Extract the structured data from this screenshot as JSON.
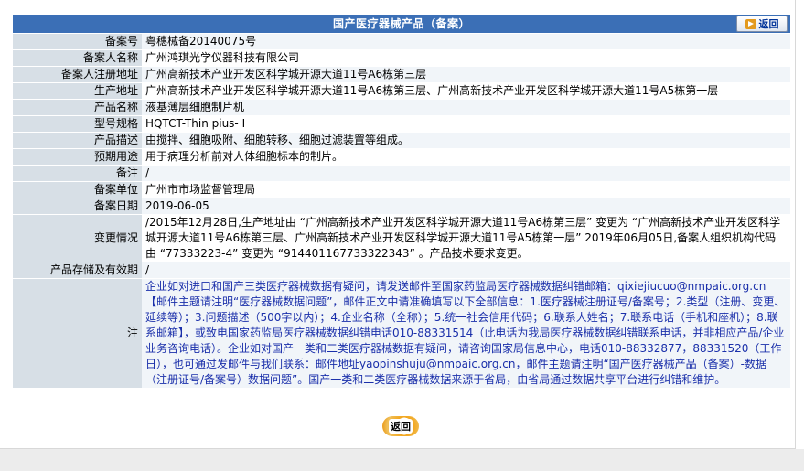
{
  "header": {
    "title": "国产医疗器械产品（备案）",
    "back_label": "返回"
  },
  "rows": [
    {
      "label": "备案号",
      "value": "粤穗械备20140075号"
    },
    {
      "label": "备案人名称",
      "value": "广州鸿琪光学仪器科技有限公司"
    },
    {
      "label": "备案人注册地址",
      "value": "广州高新技术产业开发区科学城开源大道11号A6栋第三层"
    },
    {
      "label": "生产地址",
      "value": "广州高新技术产业开发区科学城开源大道11号A6栋第三层、广州高新技术产业开发区科学城开源大道11号A5栋第一层"
    },
    {
      "label": "产品名称",
      "value": "液基薄层细胞制片机"
    },
    {
      "label": "型号规格",
      "value": "HQTCT-Thin pius- I"
    },
    {
      "label": "产品描述",
      "value": "由搅拌、细胞吸附、细胞转移、细胞过滤装置等组成。"
    },
    {
      "label": "预期用途",
      "value": "用于病理分析前对人体细胞标本的制片。"
    },
    {
      "label": "备注",
      "value": "/"
    },
    {
      "label": "备案单位",
      "value": "广州市市场监督管理局"
    },
    {
      "label": "备案日期",
      "value": "2019-06-05"
    },
    {
      "label": "变更情况",
      "value": "/2015年12月28日,生产地址由 “广州高新技术产业开发区科学城开源大道11号A6栋第三层” 变更为 “广州高新技术产业开发区科学城开源大道11号A6栋第三层、广州高新技术产业开发区科学城开源大道11号A5栋第一层” 2019年06月05日,备案人组织机构代码由 “77333223-4” 变更为 “914401167733322343” 。产品技术要求变更。"
    },
    {
      "label": "产品存储及有效期",
      "value": "/"
    }
  ],
  "notice": {
    "label": "注",
    "text": "企业如对进口和国产三类医疗器械数据有疑问，请发送邮件至国家药监局医疗器械数据纠错邮箱：qixiejiucuo@nmpaic.org.cn【邮件主题请注明“医疗器械数据问题”，邮件正文中请准确填写以下全部信息：1.医疗器械注册证号/备案号；2.类型（注册、变更、延续等）；3.问题描述（500字以内）；4.企业名称（全称）；5.统一社会信用代码；6.联系人姓名；7.联系电话（手机和座机）；8.联系邮箱】，或致电国家药监局医疗器械数据纠错电话010-88331514（此电话为我局医疗器械数据纠错联系电话，并非相应产品/企业业务咨询电话）。企业如对国产一类和二类医疗器械数据有疑问，请咨询国家局信息中心，电话010-88332877，88331520（工作日），也可通过发邮件与我们联系：邮件地址yaopinshuju@nmpaic.org.cn，邮件主题请注明“国产医疗器械产品（备案）-数据（注册证号/备案号）数据问题”。国产一类和二类医疗器械数据来源于省局，由省局通过数据共享平台进行纠错和维护。"
  },
  "footer": {
    "back_label": "返回"
  }
}
